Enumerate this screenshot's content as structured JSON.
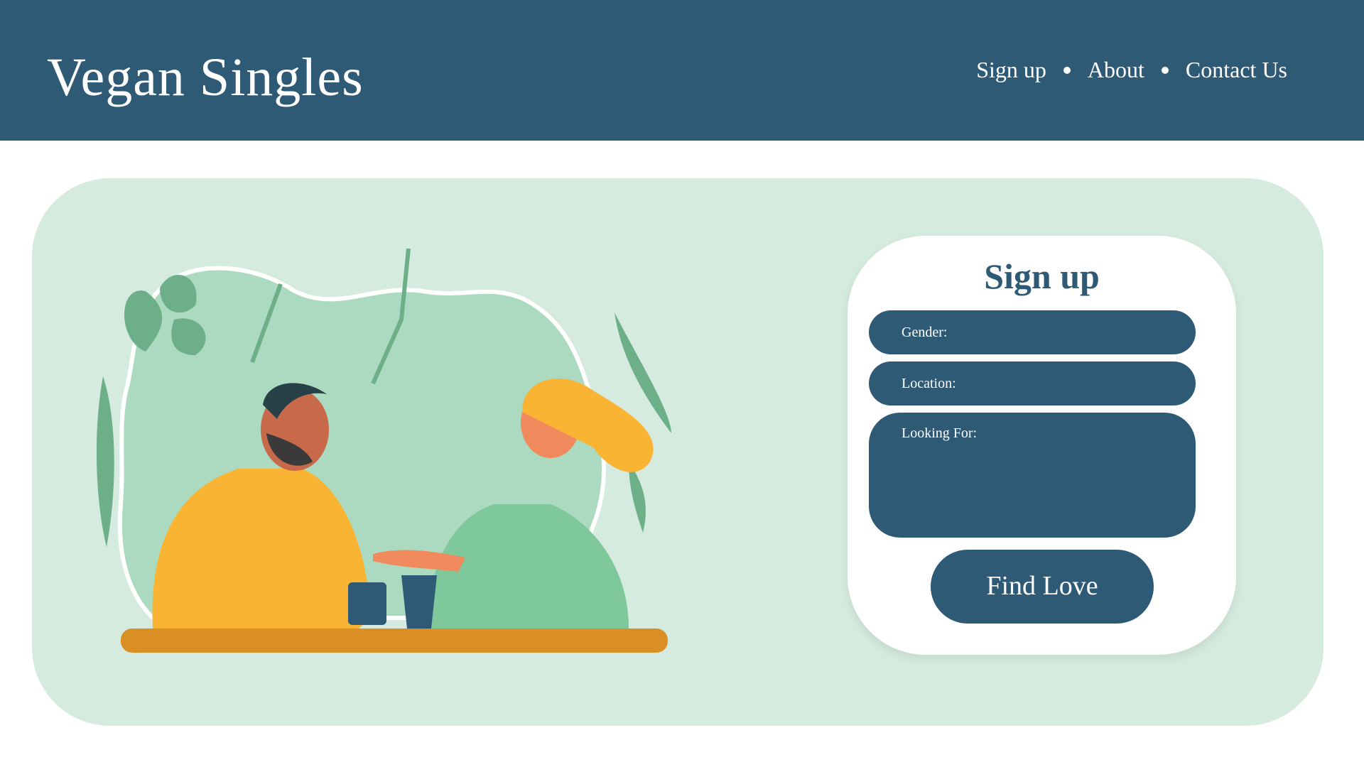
{
  "header": {
    "title": "Vegan Singles",
    "nav": [
      "Sign up",
      "About",
      "Contact Us"
    ]
  },
  "signup": {
    "title": "Sign up",
    "gender_label": "Gender:",
    "location_label": "Location:",
    "looking_label": "Looking For:",
    "button_label": "Find Love"
  },
  "colors": {
    "primary": "#2e5a76",
    "hero_bg": "#d5ebdf",
    "mustard": "#f8b432",
    "green": "#7fc89b"
  },
  "illustration": {
    "icon": "couple-date-illustration"
  }
}
